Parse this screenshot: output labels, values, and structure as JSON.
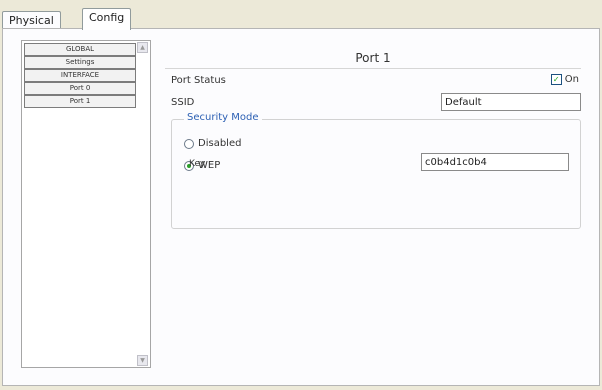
{
  "tabs": {
    "physical": "Physical",
    "config": "Config"
  },
  "nav": {
    "items": [
      "GLOBAL",
      "Settings",
      "INTERFACE",
      "Port 0",
      "Port 1"
    ]
  },
  "content": {
    "title": "Port 1",
    "port_status_label": "Port Status",
    "port_status_checkbox_label": "On",
    "port_status_checked": true,
    "ssid_label": "SSID",
    "ssid_value": "Default",
    "security_group_title": "Security Mode",
    "radio_disabled_label": "Disabled",
    "radio_wep_label": "WEP",
    "selected_security_mode": "WEP",
    "key_label": "Key",
    "key_value": "c0b4d1c0b4"
  },
  "colors": {
    "window_bg": "#ece9d8",
    "group_title_color": "#2b5fb3",
    "checkbox_check_color": "#1aa31a"
  },
  "icons": {
    "checkbox": "check-mark",
    "scroll_up": "up-arrow",
    "scroll_down": "down-arrow"
  }
}
